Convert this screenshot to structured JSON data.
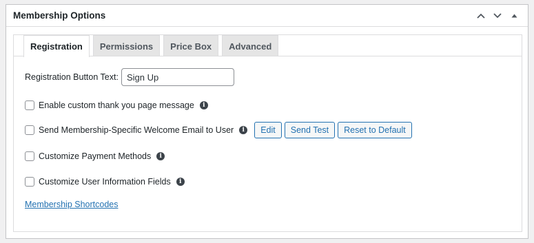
{
  "panel": {
    "title": "Membership Options"
  },
  "tabs": [
    {
      "label": "Registration"
    },
    {
      "label": "Permissions"
    },
    {
      "label": "Price Box"
    },
    {
      "label": "Advanced"
    }
  ],
  "registration": {
    "button_text_label": "Registration Button Text:",
    "button_text_value": "Sign Up",
    "thank_you_label": "Enable custom thank you page message",
    "welcome_email_label": "Send Membership-Specific Welcome Email to User",
    "edit_label": "Edit",
    "send_test_label": "Send Test",
    "reset_label": "Reset to Default",
    "payment_methods_label": "Customize Payment Methods",
    "user_fields_label": "Customize User Information Fields",
    "shortcodes_link": "Membership Shortcodes"
  },
  "icons": {
    "info": "info-icon",
    "collapse": "chevron-up-icon",
    "expand": "chevron-down-icon",
    "toggle": "triangle-up-icon"
  }
}
